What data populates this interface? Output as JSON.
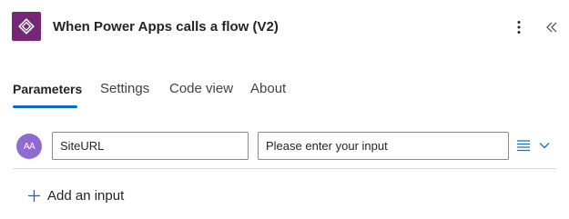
{
  "header": {
    "title": "When Power Apps calls a flow (V2)",
    "app_icon": "power-apps-icon",
    "app_icon_color": "#742774",
    "more_icon": "more-vertical-icon",
    "collapse_icon": "double-chevron-left-icon"
  },
  "tabs": [
    {
      "label": "Parameters",
      "active": true
    },
    {
      "label": "Settings",
      "active": false
    },
    {
      "label": "Code view",
      "active": false
    },
    {
      "label": "About",
      "active": false
    }
  ],
  "accent_color": "#0f6cbd",
  "input_row": {
    "avatar_text": "AA",
    "avatar_color": "#8f6bd1",
    "name_value": "SiteURL",
    "value_placeholder": "Please enter your input",
    "list_icon": "list-lines-icon",
    "expand_icon": "chevron-down-icon"
  },
  "add_input": {
    "label": "Add an input",
    "icon": "plus-icon"
  }
}
